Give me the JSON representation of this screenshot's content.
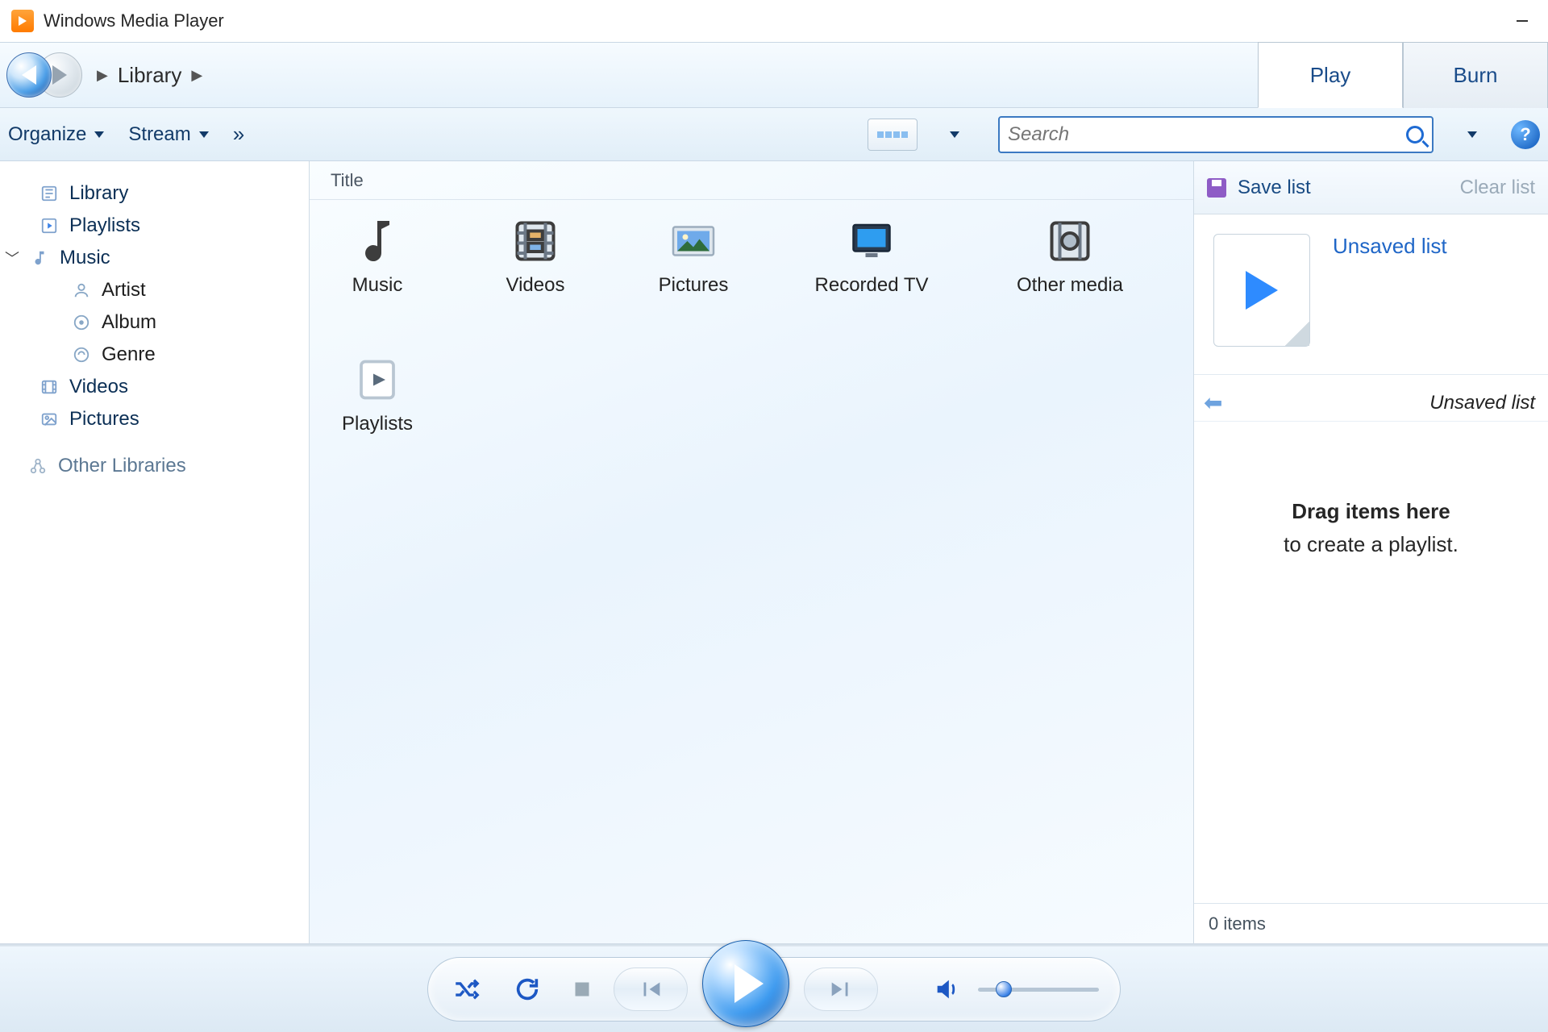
{
  "window": {
    "title": "Windows Media Player"
  },
  "breadcrumb": {
    "item1": "Library"
  },
  "tabs": {
    "play": "Play",
    "burn": "Burn"
  },
  "toolbar": {
    "organize": "Organize",
    "stream": "Stream",
    "more": "»"
  },
  "search": {
    "placeholder": "Search"
  },
  "tree": {
    "library": "Library",
    "playlists": "Playlists",
    "music": "Music",
    "artist": "Artist",
    "album": "Album",
    "genre": "Genre",
    "videos": "Videos",
    "pictures": "Pictures",
    "other_libraries": "Other Libraries"
  },
  "column": {
    "title": "Title"
  },
  "library_items": {
    "music": "Music",
    "videos": "Videos",
    "pictures": "Pictures",
    "recorded_tv": "Recorded TV",
    "other_media": "Other media",
    "playlists": "Playlists"
  },
  "rpane": {
    "save_list": "Save list",
    "clear_list": "Clear list",
    "list_title": "Unsaved list",
    "list_name": "Unsaved list",
    "drop_l1": "Drag items here",
    "drop_l2": "to create a playlist.",
    "status": "0 items"
  }
}
